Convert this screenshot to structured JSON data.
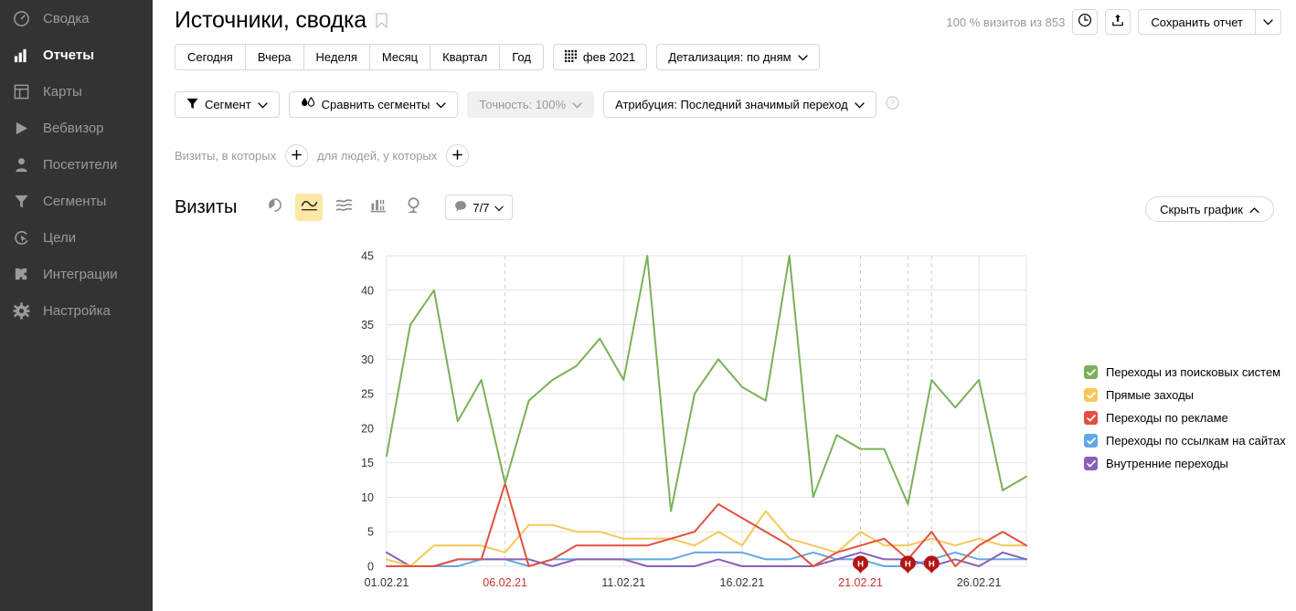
{
  "sidebar": {
    "items": [
      {
        "label": "Сводка",
        "icon": "gauge-icon",
        "active": false
      },
      {
        "label": "Отчеты",
        "icon": "bar-chart-icon",
        "active": true
      },
      {
        "label": "Карты",
        "icon": "map-layout-icon",
        "active": false
      },
      {
        "label": "Вебвизор",
        "icon": "play-icon",
        "active": false
      },
      {
        "label": "Посетители",
        "icon": "user-icon",
        "active": false
      },
      {
        "label": "Сегменты",
        "icon": "funnel-icon",
        "active": false
      },
      {
        "label": "Цели",
        "icon": "target-icon",
        "active": false
      },
      {
        "label": "Интеграции",
        "icon": "puzzle-icon",
        "active": false
      },
      {
        "label": "Настройка",
        "icon": "gear-icon",
        "active": false
      }
    ]
  },
  "header": {
    "title": "Источники, сводка",
    "bookmark_icon": "bookmark-icon",
    "visits_summary": "100 % визитов из 853",
    "history_icon": "clock-icon",
    "export_icon": "share-export-icon",
    "save_report_label": "Сохранить отчет",
    "save_report_caret_icon": "chevron-down-icon"
  },
  "period": {
    "buttons": [
      "Сегодня",
      "Вчера",
      "Неделя",
      "Месяц",
      "Квартал",
      "Год"
    ],
    "calendar_icon": "calendar-grid-icon",
    "calendar_label": "фев 2021",
    "detail_label": "Детализация: по дням",
    "detail_caret_icon": "chevron-down-icon"
  },
  "filters": {
    "segment_icon": "filter-icon",
    "segment_label": "Сегмент",
    "compare_icon": "compare-drops-icon",
    "compare_label": "Сравнить сегменты",
    "accuracy_label": "Точность: 100%",
    "attribution_label": "Атрибуция: Последний значимый переход",
    "help_icon": "question-mark-icon",
    "caret_icon": "chevron-down-icon"
  },
  "segment_builder": {
    "visits_text": "Визиты, в которых",
    "add_visits_icon": "plus-icon",
    "people_text": "для людей, у которых",
    "add_people_icon": "plus-icon"
  },
  "chart_panel": {
    "metric_title": "Визиты",
    "viz_buttons": [
      {
        "name": "pie-chart-icon",
        "active": false
      },
      {
        "name": "line-chart-icon",
        "active": true
      },
      {
        "name": "area-stack-icon",
        "active": false
      },
      {
        "name": "column-chart-icon",
        "active": false
      },
      {
        "name": "map-pin-icon",
        "active": false
      }
    ],
    "goal_icon": "speech-bubble-icon",
    "goal_label": "7/7",
    "goal_caret_icon": "chevron-down-icon",
    "hide_chart_label": "Скрыть график",
    "hide_chart_caret_icon": "chevron-up-icon",
    "colors": {
      "search": "#7bb158",
      "direct": "#f6c85a",
      "ads": "#e2503f",
      "links": "#62a8e5",
      "internal": "#8a5fb8"
    }
  },
  "chart_data": {
    "type": "line",
    "title": "Визиты",
    "xlabel": "",
    "ylabel": "",
    "ylim": [
      0,
      45
    ],
    "yticks": [
      0,
      5,
      10,
      15,
      20,
      25,
      30,
      35,
      40,
      45
    ],
    "grid": true,
    "legend_position": "right",
    "x": [
      "01.02.21",
      "02.02.21",
      "03.02.21",
      "04.02.21",
      "05.02.21",
      "06.02.21",
      "07.02.21",
      "08.02.21",
      "09.02.21",
      "10.02.21",
      "11.02.21",
      "12.02.21",
      "13.02.21",
      "14.02.21",
      "15.02.21",
      "16.02.21",
      "17.02.21",
      "18.02.21",
      "19.02.21",
      "20.02.21",
      "21.02.21",
      "22.02.21",
      "23.02.21",
      "24.02.21",
      "25.02.21",
      "26.02.21",
      "27.02.21",
      "28.02.21"
    ],
    "xtick_labels": [
      "01.02.21",
      "06.02.21",
      "11.02.21",
      "16.02.21",
      "21.02.21",
      "26.02.21"
    ],
    "xtick_indices": [
      0,
      5,
      10,
      15,
      20,
      25
    ],
    "xtick_highlight": [
      "06.02.21",
      "21.02.21"
    ],
    "holiday_markers": [
      {
        "index": 20,
        "label": "Н"
      },
      {
        "index": 22,
        "label": "Н"
      },
      {
        "index": 23,
        "label": "Н"
      }
    ],
    "series": [
      {
        "name": "Переходы из поисковых систем",
        "color": "#7bb158",
        "values": [
          16,
          35,
          40,
          21,
          27,
          12,
          24,
          27,
          29,
          33,
          27,
          45,
          8,
          25,
          30,
          26,
          24,
          45,
          10,
          19,
          17,
          17,
          9,
          27,
          23,
          27,
          11,
          13
        ]
      },
      {
        "name": "Прямые заходы",
        "color": "#f6c85a",
        "values": [
          1,
          0,
          3,
          3,
          3,
          2,
          6,
          6,
          5,
          5,
          4,
          4,
          4,
          3,
          5,
          3,
          8,
          4,
          3,
          2,
          5,
          3,
          3,
          4,
          3,
          4,
          3,
          3
        ]
      },
      {
        "name": "Переходы по рекламе",
        "color": "#e2503f",
        "values": [
          0,
          0,
          0,
          1,
          1,
          12,
          0,
          1,
          3,
          3,
          3,
          3,
          4,
          5,
          9,
          7,
          5,
          3,
          0,
          2,
          3,
          4,
          1,
          5,
          0,
          3,
          5,
          3
        ]
      },
      {
        "name": "Переходы по ссылкам на сайтах",
        "color": "#62a8e5",
        "values": [
          0,
          0,
          0,
          0,
          1,
          1,
          0,
          1,
          1,
          1,
          1,
          1,
          1,
          2,
          2,
          2,
          1,
          1,
          2,
          1,
          1,
          0,
          0,
          1,
          2,
          1,
          1,
          1
        ]
      },
      {
        "name": "Внутренние переходы",
        "color": "#8a5fb8",
        "values": [
          2,
          0,
          0,
          1,
          1,
          1,
          1,
          0,
          1,
          1,
          1,
          0,
          0,
          0,
          1,
          0,
          0,
          0,
          0,
          1,
          2,
          1,
          1,
          0,
          1,
          0,
          2,
          1
        ]
      }
    ]
  },
  "legend": {
    "items": [
      {
        "label": "Переходы из поисковых систем",
        "color": "#7bb158",
        "checked": true
      },
      {
        "label": "Прямые заходы",
        "color": "#f6c85a",
        "checked": true
      },
      {
        "label": "Переходы по рекламе",
        "color": "#e2503f",
        "checked": true
      },
      {
        "label": "Переходы по ссылкам на сайтах",
        "color": "#62a8e5",
        "checked": true
      },
      {
        "label": "Внутренние переходы",
        "color": "#8a5fb8",
        "checked": true
      }
    ]
  }
}
